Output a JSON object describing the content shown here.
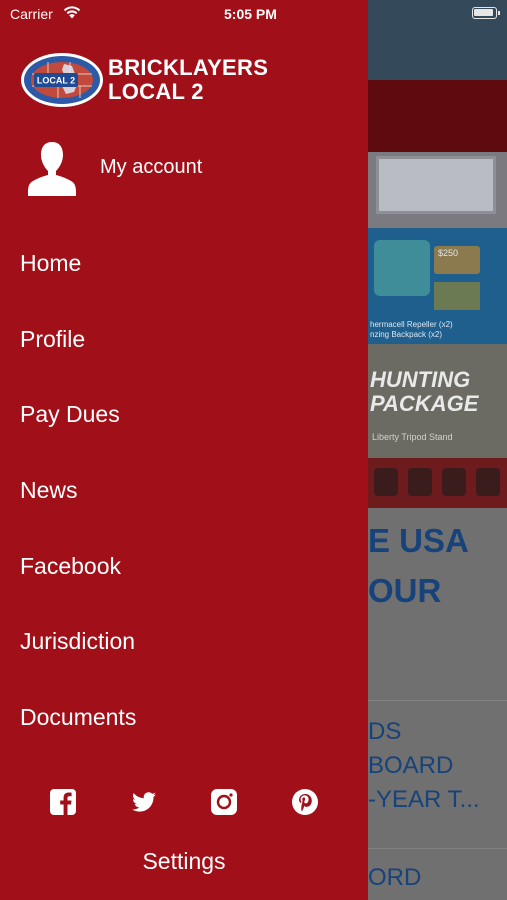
{
  "status_bar": {
    "carrier": "Carrier",
    "time": "5:05 PM"
  },
  "drawer": {
    "logo_text": "LOCAL 2",
    "brand_line1": "BRICKLAYERS",
    "brand_line2": "LOCAL 2",
    "account_label": "My account",
    "menu": [
      {
        "label": "Home"
      },
      {
        "label": "Profile"
      },
      {
        "label": "Pay Dues"
      },
      {
        "label": "News"
      },
      {
        "label": "Facebook"
      },
      {
        "label": "Jurisdiction"
      },
      {
        "label": "Documents"
      }
    ],
    "social_icons": [
      "facebook-icon",
      "twitter-icon",
      "instagram-icon",
      "pinterest-icon"
    ],
    "settings_label": "Settings"
  },
  "background": {
    "promo1_text": "",
    "promo2_price": "$250",
    "promo2_caption_line1": "hermacell Repeller (x2)",
    "promo2_caption_line2": "nzing Backpack (x2)",
    "promo3_title_line1": "HUNTING",
    "promo3_title_line2": "PACKAGE",
    "promo3_caption": "Liberty Tripod Stand",
    "headline_line1": "E USA",
    "headline_line2": "OUR",
    "news_line1": "DS",
    "news_line2": "BOARD",
    "news_line3": "-YEAR T...",
    "news2_line1": "ORD"
  },
  "colors": {
    "drawer_bg": "#a10f18",
    "headline_blue": "#17427a",
    "header_bg": "#34495a"
  }
}
